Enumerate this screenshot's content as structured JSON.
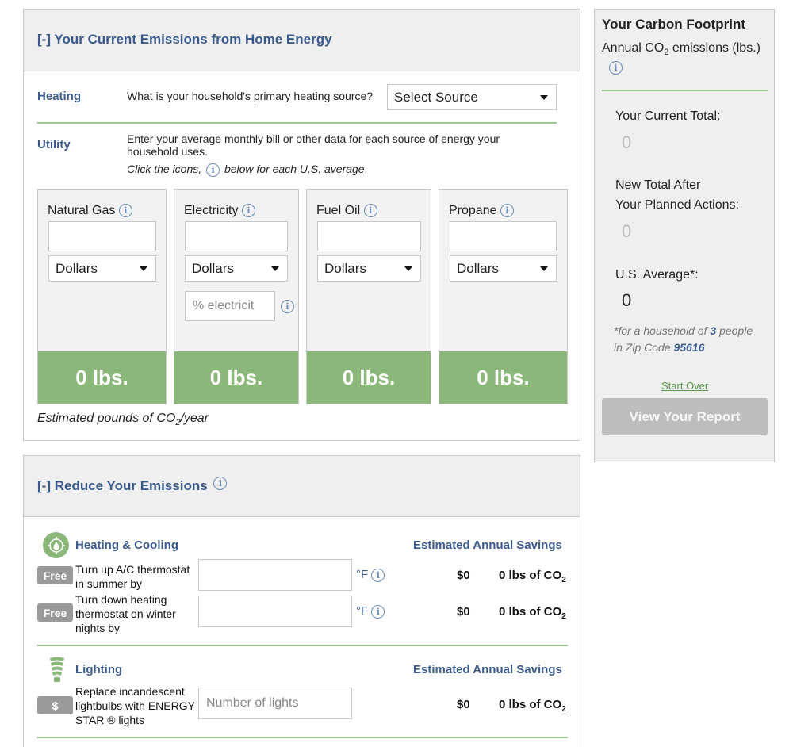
{
  "emissions_panel": {
    "title": "[-] Your Current Emissions from Home Energy",
    "heating_label": "Heating",
    "heating_question": "What is your household's primary heating source?",
    "heating_select": "Select Source",
    "utility_label": "Utility",
    "utility_text": "Enter your average monthly bill or other data for each source of energy your household uses.",
    "click_hint_prefix": "Click the icons,",
    "click_hint_suffix": "below for each U.S. average",
    "sources": [
      {
        "name": "Natural Gas",
        "unit": "Dollars",
        "result": "0 lbs."
      },
      {
        "name": "Electricity",
        "unit": "Dollars",
        "pct_placeholder": "% electricit",
        "result": "0 lbs."
      },
      {
        "name": "Fuel Oil",
        "unit": "Dollars",
        "result": "0 lbs."
      },
      {
        "name": "Propane",
        "unit": "Dollars",
        "result": "0 lbs."
      }
    ],
    "footnote_prefix": "Estimated pounds of CO",
    "footnote_sub": "2",
    "footnote_suffix": "/year"
  },
  "reduce_panel": {
    "title": "[-] Reduce Your Emissions",
    "sections": [
      {
        "title": "Heating & Cooling",
        "savings_label": "Estimated Annual Savings",
        "actions": [
          {
            "badge": "Free",
            "text": "Turn up A/C thermostat in summer by",
            "unit": "°F",
            "money": "$0",
            "co2_prefix": "0 lbs of CO",
            "co2_sub": "2"
          },
          {
            "badge": "Free",
            "text": "Turn down heating thermostat on winter nights by",
            "unit": "°F",
            "money": "$0",
            "co2_prefix": "0 lbs of CO",
            "co2_sub": "2"
          }
        ]
      },
      {
        "title": "Lighting",
        "savings_label": "Estimated Annual Savings",
        "actions": [
          {
            "badge": "$",
            "text": "Replace incandescent lightbulbs with ENERGY STAR ® lights",
            "placeholder": "Number of lights",
            "money": "$0",
            "co2_prefix": "0 lbs of CO",
            "co2_sub": "2"
          }
        ]
      }
    ]
  },
  "sidebar": {
    "title": "Your Carbon Footprint",
    "subtitle_prefix": "Annual CO",
    "subtitle_sub": "2",
    "subtitle_suffix": " emissions (lbs.)",
    "current_label": "Your Current Total:",
    "current_value": "0",
    "new_total_line1": "New Total After",
    "new_total_line2": "Your Planned Actions:",
    "new_total_value": "0",
    "us_avg_label": "U.S. Average*:",
    "us_avg_value": "0",
    "household_prefix": "*for a household of ",
    "household_count": "3",
    "household_mid": " people",
    "zip_prefix": "in Zip Code ",
    "zip_code": "95616",
    "start_over": "Start Over",
    "view_report": "View Your Report"
  },
  "colors": {
    "accent_blue": "#3a5a8c",
    "green": "#8bb87a",
    "divider_green": "#9fc58f",
    "panel_gray": "#efefef"
  }
}
